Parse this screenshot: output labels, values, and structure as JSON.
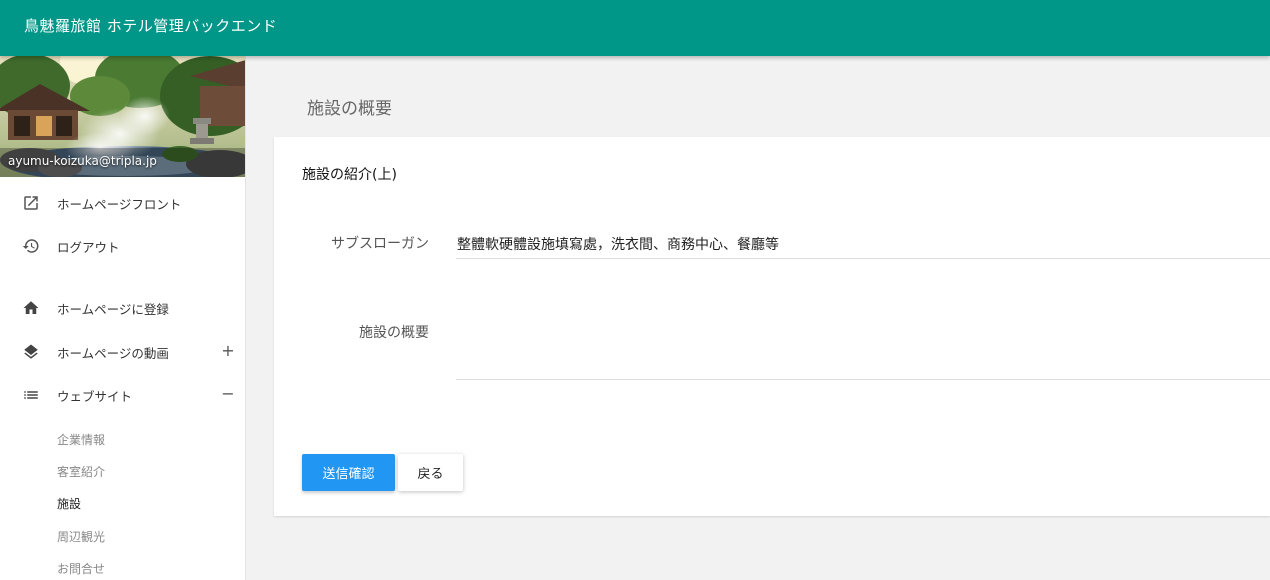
{
  "app": {
    "title": "鳥魅羅旅館 ホテル管理バックエンド",
    "brand_color": "#009688"
  },
  "sidebar": {
    "user_email": "ayumu-koizuka@tripla.jp",
    "items": [
      {
        "label": "ホームページフロント",
        "icon": "open-external-icon"
      },
      {
        "label": "ログアウト",
        "icon": "history-icon"
      },
      {
        "label": "ホームページに登録",
        "icon": "home-icon"
      },
      {
        "label": "ホームページの動画",
        "icon": "layers-icon",
        "toggle": "+"
      },
      {
        "label": "ウェブサイト",
        "icon": "list-icon",
        "toggle": "−"
      }
    ],
    "subitems": [
      {
        "label": "企業情報",
        "active": false
      },
      {
        "label": "客室紹介",
        "active": false
      },
      {
        "label": "施設",
        "active": true
      },
      {
        "label": "周辺観光",
        "active": false
      },
      {
        "label": "お問合せ",
        "active": false
      }
    ]
  },
  "main": {
    "page_title": "施設の概要",
    "card": {
      "section_title": "施設の紹介(上)",
      "fields": {
        "slogan_label": "サブスローガン",
        "slogan_value": "整體軟硬體設施填寫處，洗衣間、商務中心、餐廳等",
        "overview_label": "施設の概要",
        "overview_value": ""
      },
      "buttons": {
        "submit_label": "送信確認",
        "back_label": "戻る"
      }
    },
    "accent_color": "#2196f3"
  }
}
